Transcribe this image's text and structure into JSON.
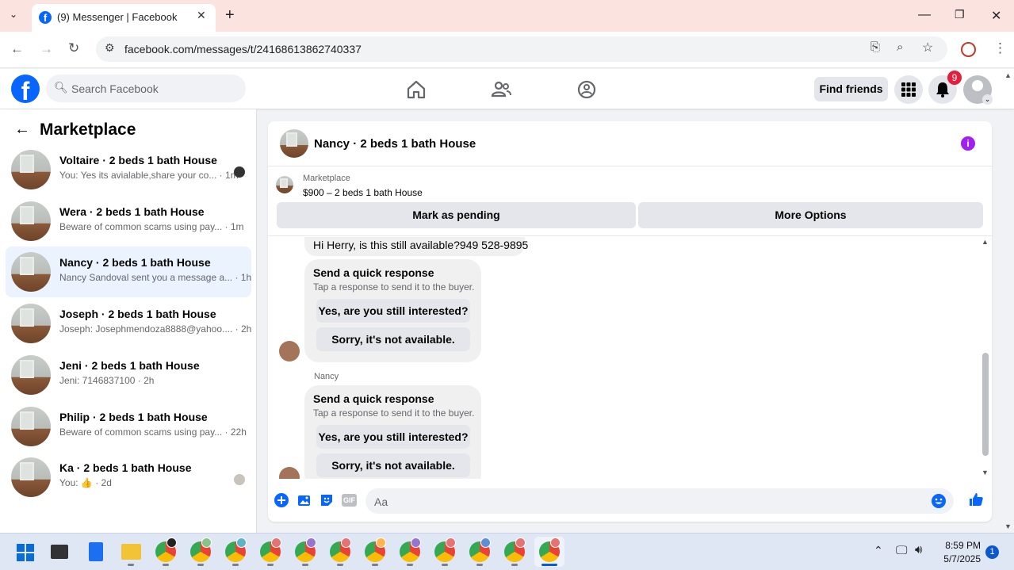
{
  "browser": {
    "tab_title": "(9) Messenger | Facebook",
    "url": "facebook.com/messages/t/24168613862740337"
  },
  "fb": {
    "search_placeholder": "Search Facebook",
    "find_friends": "Find friends",
    "notification_count": "9"
  },
  "sidebar": {
    "title": "Marketplace",
    "conversations": [
      {
        "name": "Voltaire · 2 beds 1 bath House",
        "preview": "You: Yes its avialable,share your co... · 1m"
      },
      {
        "name": "Wera · 2 beds 1 bath House",
        "preview": "Beware of common scams using pay... · 1m"
      },
      {
        "name": "Nancy · 2 beds 1 bath House",
        "preview": "Nancy Sandoval sent you a message a... · 1h"
      },
      {
        "name": "Joseph · 2 beds 1 bath House",
        "preview": "Joseph: Josephmendoza8888@yahoo.... · 2h"
      },
      {
        "name": "Jeni · 2 beds 1 bath House",
        "preview": "Jeni: 7146837100 · 2h"
      },
      {
        "name": "Philip · 2 beds 1 bath House",
        "preview": "Beware of common scams using pay... · 22h"
      },
      {
        "name": "Ka · 2 beds 1 bath House",
        "preview": "You: 👍 · 2d"
      }
    ]
  },
  "chat": {
    "title": "Nancy · 2 beds 1 bath House",
    "marketplace_label": "Marketplace",
    "listing": "$900 – 2 beds 1 bath House",
    "mark_pending": "Mark as pending",
    "more_options": "More Options",
    "first_message": "Hi Herry, is this still available?949 528-9895",
    "quick_title": "Send a quick response",
    "quick_sub": "Tap a response to send it to the buyer.",
    "quick_yes": "Yes, are you still interested?",
    "quick_no": "Sorry, it's not available.",
    "sender_name": "Nancy",
    "composer_placeholder": "Aa"
  },
  "taskbar": {
    "time": "8:59 PM",
    "date": "5/7/2025",
    "notif_count": "1"
  }
}
